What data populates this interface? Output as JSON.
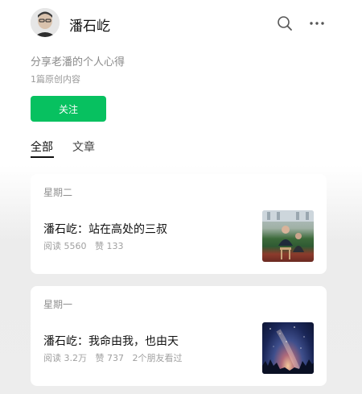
{
  "account": {
    "name": "潘石屹",
    "description": "分享老潘的个人心得",
    "original_count": "1篇原创内容",
    "follow_label": "关注"
  },
  "header": {
    "search_icon": "search-icon",
    "more_icon": "more-icon"
  },
  "tabs": [
    {
      "label": "全部",
      "active": true
    },
    {
      "label": "文章",
      "active": false
    }
  ],
  "articles": [
    {
      "day": "星期二",
      "title": "潘石屹：站在高处的三叔",
      "reads": "阅读 5560",
      "likes": "赞 133",
      "friends": ""
    },
    {
      "day": "星期一",
      "title": "潘石屹：我命由我，也由天",
      "reads": "阅读 3.2万",
      "likes": "赞 737",
      "friends": "2个朋友看过"
    }
  ],
  "colors": {
    "accent": "#07c160",
    "muted": "#8a8a8a"
  }
}
